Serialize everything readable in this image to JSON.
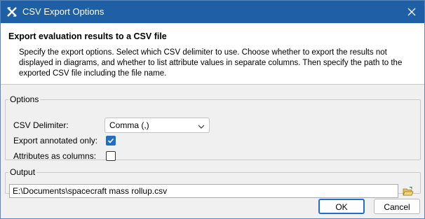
{
  "window": {
    "title": "CSV Export Options",
    "app_icon": "x-app-icon",
    "close_icon": "close-icon"
  },
  "header": {
    "title": "Export evaluation results to a CSV file",
    "description": "Specify the export options. Select which CSV delimiter to use. Choose whether to export the results not displayed in diagrams, and whether to list attribute values in separate columns. Then specify the path to the exported CSV file including the file name."
  },
  "options": {
    "legend": "Options",
    "delimiter_label": "CSV Delimiter:",
    "delimiter_value": "Comma (,)",
    "annotated_label": "Export annotated only:",
    "annotated_checked": true,
    "attributes_label": "Attributes as columns:",
    "attributes_checked": false
  },
  "output": {
    "legend": "Output",
    "path_value": "E:\\Documents\\spacecraft mass rollup.csv",
    "browse_icon": "folder-open-icon"
  },
  "buttons": {
    "ok_label": "OK",
    "cancel_label": "Cancel"
  },
  "colors": {
    "titlebar": "#1f5fa5",
    "accent": "#1f6fc5"
  }
}
